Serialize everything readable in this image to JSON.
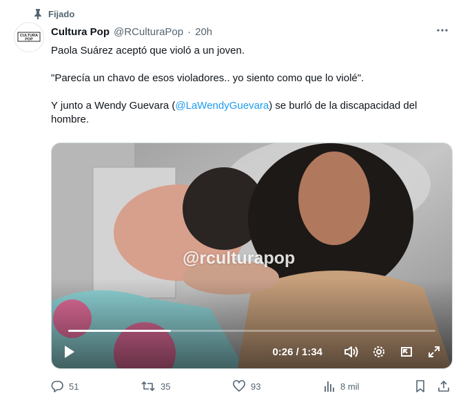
{
  "pinned": {
    "label": "Fijado",
    "icon": "pin-icon"
  },
  "author": {
    "name": "Cultura Pop",
    "handle": "@RCulturaPop",
    "separator": "·",
    "time": "20h",
    "avatar_text": "CULTURA POP"
  },
  "tweet": {
    "line1": "Paola Suárez aceptó que violó a un joven.",
    "line2": "\"Parecía un chavo de esos violadores.. yo siento como que lo violé\".",
    "line3_pre": "Y junto a Wendy Guevara (",
    "line3_mention": "@LaWendyGuevara",
    "line3_post": ") se burló de la discapacidad del hombre."
  },
  "video": {
    "watermark": "@rculturapop",
    "time_display": "0:26 / 1:34",
    "progress": 0.28
  },
  "actions": {
    "replies": "51",
    "retweets": "35",
    "likes": "93",
    "views": "8 mil"
  },
  "colors": {
    "accent": "#1d9bf0",
    "muted": "#536471",
    "text": "#0f1419"
  }
}
